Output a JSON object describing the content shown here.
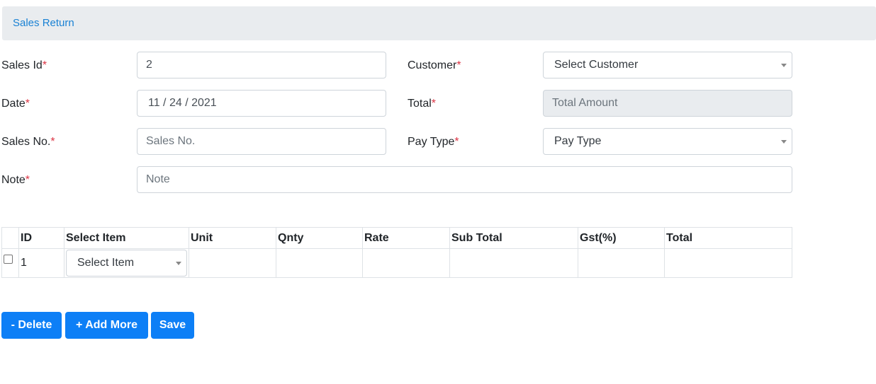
{
  "header": {
    "title": "Sales Return"
  },
  "form": {
    "sales_id": {
      "label": "Sales Id",
      "required": "*",
      "value": "2"
    },
    "customer": {
      "label": "Customer",
      "required": "*",
      "selected": "Select Customer"
    },
    "date": {
      "label": "Date",
      "required": "*",
      "value": "11 / 24 / 2021"
    },
    "total": {
      "label": "Total",
      "required": "*",
      "placeholder": "Total Amount"
    },
    "sales_no": {
      "label": "Sales No.",
      "required": "*",
      "placeholder": "Sales No."
    },
    "pay_type": {
      "label": "Pay Type",
      "required": "*",
      "selected": "Pay Type"
    },
    "note": {
      "label": "Note",
      "required": "*",
      "placeholder": "Note"
    }
  },
  "table": {
    "columns": [
      "",
      "ID",
      "Select Item",
      "Unit",
      "Qnty",
      "Rate",
      "Sub Total",
      "Gst(%)",
      "Total"
    ],
    "rows": [
      {
        "id": "1",
        "item_selected": "Select Item",
        "unit": "",
        "qnty": "",
        "rate": "",
        "sub_total": "",
        "gst": "",
        "total": ""
      }
    ]
  },
  "buttons": {
    "delete": "- Delete",
    "add_more": "+ Add More",
    "save": "Save"
  },
  "colors": {
    "primary": "#0d7ff6",
    "header_bg": "#e9ecef",
    "header_text": "#1a82d4",
    "required": "#dc3545"
  }
}
